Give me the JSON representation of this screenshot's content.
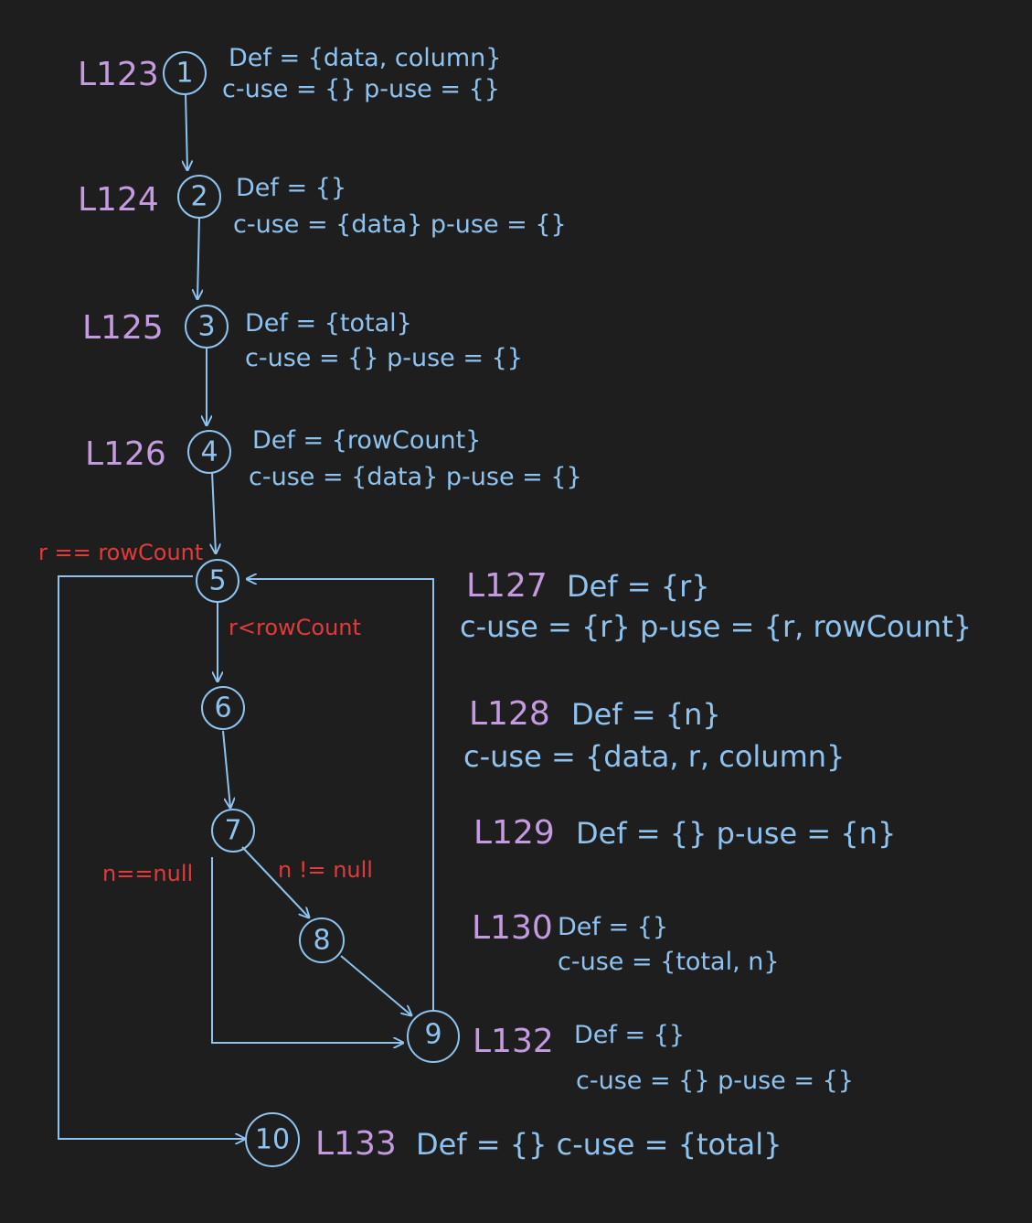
{
  "nodes": [
    {
      "id": "1",
      "line": "L123",
      "def": "Def = {data, column}",
      "uses": "c-use = {}  p-use = {}"
    },
    {
      "id": "2",
      "line": "L124",
      "def": "Def = {}",
      "uses": "c-use = {data}  p-use = {}"
    },
    {
      "id": "3",
      "line": "L125",
      "def": "Def = {total}",
      "uses": "c-use = {}  p-use = {}"
    },
    {
      "id": "4",
      "line": "L126",
      "def": "Def = {rowCount}",
      "uses": "c-use = {data}  p-use = {}"
    },
    {
      "id": "5"
    },
    {
      "id": "6"
    },
    {
      "id": "7"
    },
    {
      "id": "8"
    },
    {
      "id": "9",
      "line": "L132",
      "def": "Def = {}",
      "uses": "c-use = {}  p-use = {}"
    },
    {
      "id": "10",
      "line": "L133",
      "def": "Def = {}  c-use = {total}"
    }
  ],
  "side_notes": [
    {
      "line": "L127",
      "def": "Def = {r}",
      "uses": "c-use = {r}  p-use = {r, rowCount}"
    },
    {
      "line": "L128",
      "def": "Def = {n}",
      "uses": "c-use = {data, r, column}"
    },
    {
      "line": "L129",
      "def": "Def = {}  p-use = {n}",
      "uses": ""
    },
    {
      "line": "L130",
      "def": "Def = {}",
      "uses": "c-use = {total, n}"
    }
  ],
  "conditions": {
    "exit_loop": "r == rowCount",
    "enter_loop": "r<rowCount",
    "n_null": "n==null",
    "n_not_null": "n != null"
  },
  "colors": {
    "background": "#1f1e1e",
    "line_labels": "#c49ae0",
    "nodes_and_text": "#8ec3f0",
    "conditions": "#e23a3a"
  }
}
